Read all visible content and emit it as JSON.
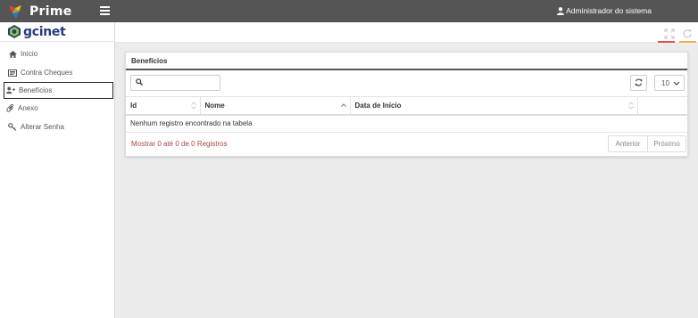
{
  "topbar": {
    "brand": "Prime",
    "user": "Administrador do sistema"
  },
  "sidebar": {
    "logo_text": "gcinet",
    "items": [
      {
        "label": "Início",
        "icon": "home-icon"
      },
      {
        "label": "Contra Cheques",
        "icon": "document-icon"
      },
      {
        "label": "Benefícios",
        "icon": "user-add-icon",
        "active": true
      },
      {
        "label": "Anexo",
        "icon": "paperclip-icon"
      },
      {
        "label": "Alterar Senha",
        "icon": "key-icon"
      }
    ]
  },
  "panel": {
    "title": "Benefícios",
    "search_placeholder": "",
    "page_size": "10",
    "columns": [
      "Id",
      "Nome",
      "Data de Início",
      ""
    ],
    "empty_message": "Nenhum registro encontrado na tabela",
    "info": "Mostrar 0 até 0 de 0 Registros",
    "prev_label": "Anterior",
    "next_label": "Próximo"
  },
  "colors": {
    "topbar": "#555555",
    "accent_red": "#d9534f",
    "accent_yellow": "#f0ad4e",
    "info_text": "#a94442",
    "logo_blue": "#2a3a78"
  }
}
